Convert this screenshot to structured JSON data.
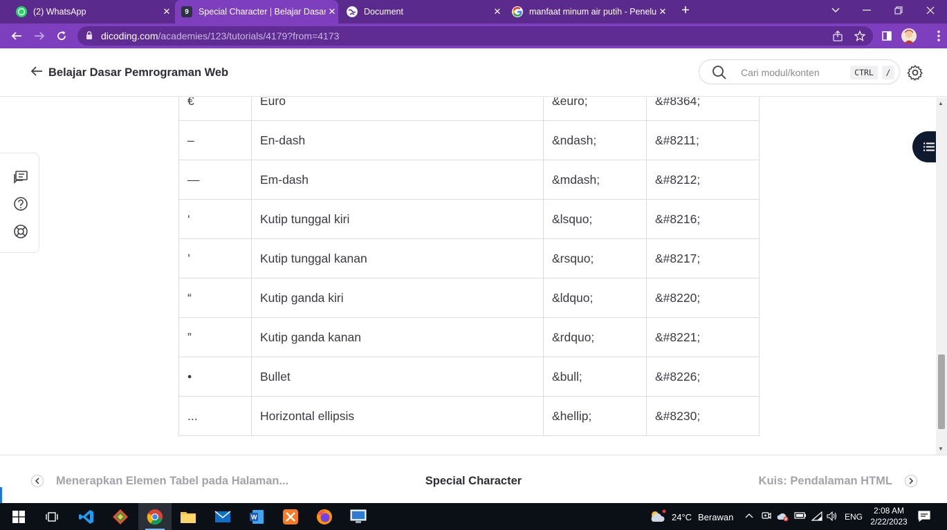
{
  "browser": {
    "tabs": [
      {
        "title": "(2) WhatsApp",
        "icon": "whatsapp-icon",
        "active": false
      },
      {
        "title": "Special Character | Belajar Dasar Pemrograman Web",
        "icon": "dicoding-icon",
        "active": true
      },
      {
        "title": "Document",
        "icon": "globe-icon",
        "active": false
      },
      {
        "title": "manfaat minum air putih - Penelusuran Google",
        "icon": "google-icon",
        "active": false
      }
    ],
    "new_tab_label": "+",
    "url_host": "dicoding.com",
    "url_path": "/academies/123/tutorials/4179?from=4173",
    "theme_color": "#7d3fbd"
  },
  "header": {
    "course_title": "Belajar Dasar Pemrograman Web",
    "search_placeholder": "Cari modul/konten",
    "shortcut_key_1": "CTRL",
    "shortcut_key_2": "/"
  },
  "table": {
    "rows": [
      {
        "char": "€",
        "name": "Euro",
        "entity": "&euro;",
        "code": "&#8364;"
      },
      {
        "char": "–",
        "name": "En-dash",
        "entity": "&ndash;",
        "code": "&#8211;"
      },
      {
        "char": "—",
        "name": "Em-dash",
        "entity": "&mdash;",
        "code": "&#8212;"
      },
      {
        "char": "‘",
        "name": "Kutip tunggal kiri",
        "entity": "&lsquo;",
        "code": "&#8216;"
      },
      {
        "char": "’",
        "name": "Kutip tunggal kanan",
        "entity": "&rsquo;",
        "code": "&#8217;"
      },
      {
        "char": "“",
        "name": "Kutip ganda kiri",
        "entity": "&ldquo;",
        "code": "&#8220;"
      },
      {
        "char": "”",
        "name": "Kutip ganda kanan",
        "entity": "&rdquo;",
        "code": "&#8221;"
      },
      {
        "char": "•",
        "name": "Bullet",
        "entity": "&bull;",
        "code": "&#8226;"
      },
      {
        "char": "...",
        "name": "Horizontal ellipsis",
        "entity": "&hellip;",
        "code": "&#8230;"
      }
    ]
  },
  "bottom_nav": {
    "prev": "Menerapkan Elemen Tabel pada Halaman...",
    "current": "Special Character",
    "next": "Kuis: Pendalaman HTML"
  },
  "taskbar": {
    "weather_temp": "24°C",
    "weather_desc": "Berawan",
    "language": "ENG",
    "time": "2:08 AM",
    "date": "2/22/2023"
  }
}
